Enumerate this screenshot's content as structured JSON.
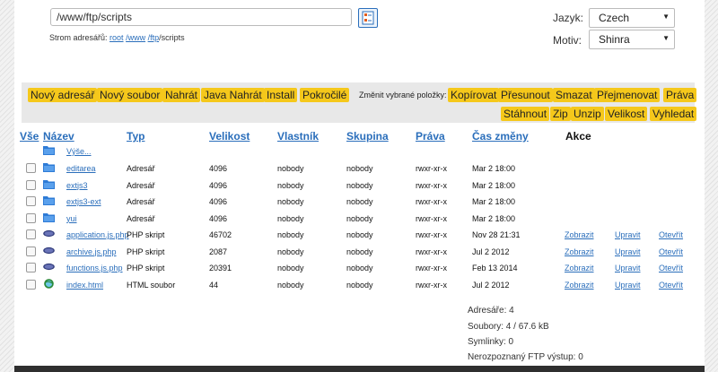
{
  "path": {
    "value": "/www/ftp/scripts"
  },
  "breadcrumb": {
    "label": "Strom adresářů:",
    "parts": [
      "root",
      "/www",
      "/ftp",
      "/scripts"
    ]
  },
  "prefs": {
    "language_label": "Jazyk:",
    "language_value": "Czech",
    "theme_label": "Motiv:",
    "theme_value": "Shinra"
  },
  "toolbar": {
    "left": [
      "Nový adresář",
      "Nový soubor",
      "Nahrát",
      "Java Nahrát",
      "Install",
      "Pokročilé"
    ],
    "change_label": "Změnit vybrané položky:",
    "right_row1": [
      "Kopírovat",
      "Přesunout",
      "Smazat",
      "Přejmenovat",
      "Práva"
    ],
    "right_row2": [
      "Stáhnout",
      "Zip",
      "Unzip",
      "Velikost",
      "Vyhledat"
    ]
  },
  "table": {
    "headers": {
      "all": "Vše",
      "name": "Název",
      "type": "Typ",
      "size": "Velikost",
      "owner": "Vlastník",
      "group": "Skupina",
      "perms": "Práva",
      "mtime": "Čas změny",
      "actions": "Akce"
    },
    "up_label": "Výše...",
    "rows": [
      {
        "name": "editarea",
        "type": "Adresář",
        "size": "4096",
        "owner": "nobody",
        "group": "nobody",
        "perms": "rwxr-xr-x",
        "mtime": "Mar 2 18:00",
        "kind": "folder-icon",
        "actions": []
      },
      {
        "name": "extjs3",
        "type": "Adresář",
        "size": "4096",
        "owner": "nobody",
        "group": "nobody",
        "perms": "rwxr-xr-x",
        "mtime": "Mar 2 18:00",
        "kind": "folder-icon",
        "actions": []
      },
      {
        "name": "extjs3-ext",
        "type": "Adresář",
        "size": "4096",
        "owner": "nobody",
        "group": "nobody",
        "perms": "rwxr-xr-x",
        "mtime": "Mar 2 18:00",
        "kind": "folder-icon",
        "actions": []
      },
      {
        "name": "yui",
        "type": "Adresář",
        "size": "4096",
        "owner": "nobody",
        "group": "nobody",
        "perms": "rwxr-xr-x",
        "mtime": "Mar 2 18:00",
        "kind": "folder-icon",
        "actions": []
      },
      {
        "name": "application.js.php",
        "type": "PHP skript",
        "size": "46702",
        "owner": "nobody",
        "group": "nobody",
        "perms": "rwxr-xr-x",
        "mtime": "Nov 28 21:31",
        "kind": "php-file-icon",
        "actions": [
          "Zobrazit",
          "Upravit",
          "Otevřít"
        ]
      },
      {
        "name": "archive.js.php",
        "type": "PHP skript",
        "size": "2087",
        "owner": "nobody",
        "group": "nobody",
        "perms": "rwxr-xr-x",
        "mtime": "Jul 2 2012",
        "kind": "php-file-icon",
        "actions": [
          "Zobrazit",
          "Upravit",
          "Otevřít"
        ]
      },
      {
        "name": "functions.js.php",
        "type": "PHP skript",
        "size": "20391",
        "owner": "nobody",
        "group": "nobody",
        "perms": "rwxr-xr-x",
        "mtime": "Feb 13 2014",
        "kind": "php-file-icon",
        "actions": [
          "Zobrazit",
          "Upravit",
          "Otevřít"
        ]
      },
      {
        "name": "index.html",
        "type": "HTML soubor",
        "size": "44",
        "owner": "nobody",
        "group": "nobody",
        "perms": "rwxr-xr-x",
        "mtime": "Jul 2 2012",
        "kind": "html-file-icon",
        "actions": [
          "Zobrazit",
          "Upravit",
          "Otevřít"
        ]
      }
    ]
  },
  "stats": {
    "dirs": "Adresáře: 4",
    "files": "Soubory: 4 / 67.6 kB",
    "symlinks": "Symlinky: 0",
    "unknown": "Nerozpoznaný FTP výstup: 0"
  },
  "colors": {
    "accent": "#2a6ebb",
    "button": "#f5c81b",
    "toolbar_bg": "#e8e8e8"
  }
}
